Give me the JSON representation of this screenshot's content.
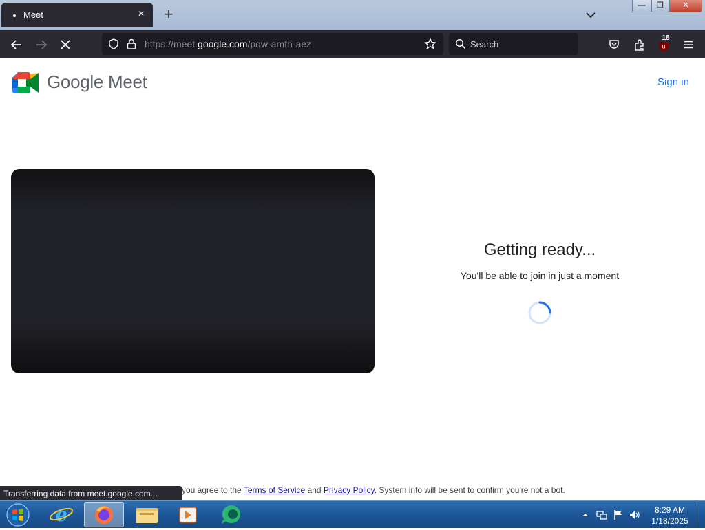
{
  "browser": {
    "tab_title": "Meet",
    "tab_close_icon": "close-icon",
    "url_prefix": "https://meet.",
    "url_domain": "google.com",
    "url_path": "/pqw-amfh-aez",
    "search_placeholder": "Search",
    "extension_badge": "18"
  },
  "page": {
    "brand": "Google Meet",
    "sign_in": "Sign in",
    "heading": "Getting ready...",
    "subtext": "You'll be able to join in just a moment",
    "footer_prefix": "you agree to the ",
    "footer_terms": "Terms of Service",
    "footer_and": " and ",
    "footer_privacy": "Privacy Policy",
    "footer_suffix": ". System info will be sent to confirm you're not a bot."
  },
  "status": {
    "text": "Transferring data from meet.google.com..."
  },
  "taskbar": {
    "time": "8:29 AM",
    "date": "1/18/2025"
  },
  "colors": {
    "accent": "#1a73e8",
    "browser_dark": "#2b2a33",
    "taskbar": "#1d5697"
  }
}
